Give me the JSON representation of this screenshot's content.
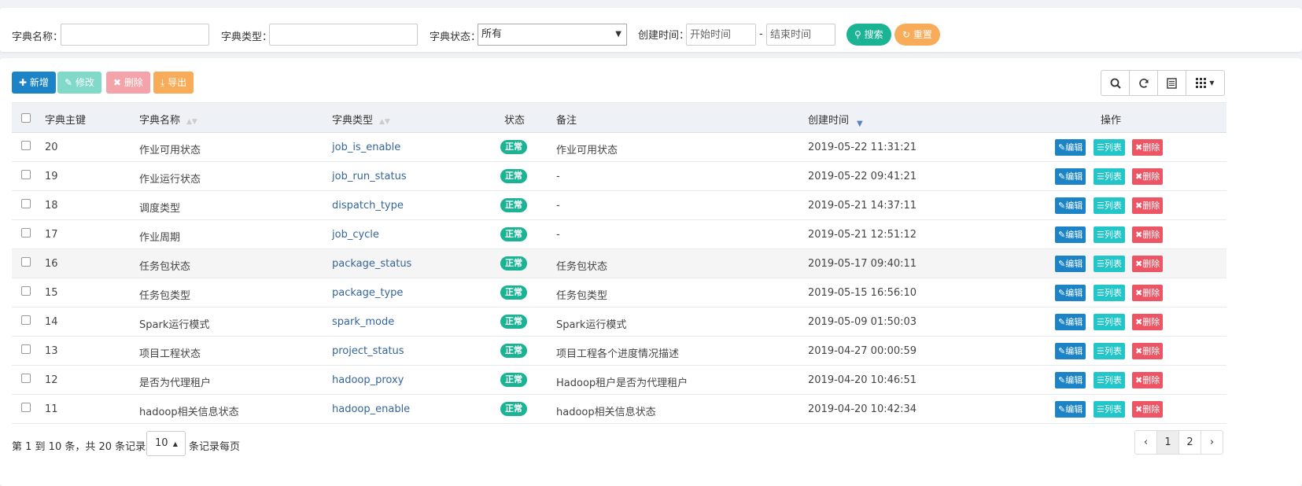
{
  "search": {
    "dict_name_label": "字典名称：",
    "dict_type_label": "字典类型：",
    "dict_status_label": "字典状态：",
    "dict_status_value": "所有",
    "create_time_label": "创建时间：",
    "start_placeholder": "开始时间",
    "dash": "-",
    "end_placeholder": "结束时间",
    "search_button": "搜索",
    "reset_button": "重置"
  },
  "toolbar": {
    "add": "新增",
    "edit": "修改",
    "delete": "删除",
    "export": "导出"
  },
  "table": {
    "headers": {
      "id": "字典主键",
      "name": "字典名称",
      "type": "字典类型",
      "status": "状态",
      "remark": "备注",
      "created": "创建时间",
      "actions": "操作"
    },
    "actions": {
      "edit": "编辑",
      "list": "列表",
      "delete": "删除"
    },
    "rows": [
      {
        "id": "20",
        "name": "作业可用状态",
        "type": "job_is_enable",
        "status": "正常",
        "remark": "作业可用状态",
        "created": "2019-05-22 11:31:21"
      },
      {
        "id": "19",
        "name": "作业运行状态",
        "type": "job_run_status",
        "status": "正常",
        "remark": "-",
        "created": "2019-05-22 09:41:21"
      },
      {
        "id": "18",
        "name": "调度类型",
        "type": "dispatch_type",
        "status": "正常",
        "remark": "-",
        "created": "2019-05-21 14:37:11"
      },
      {
        "id": "17",
        "name": "作业周期",
        "type": "job_cycle",
        "status": "正常",
        "remark": "-",
        "created": "2019-05-21 12:51:12"
      },
      {
        "id": "16",
        "name": "任务包状态",
        "type": "package_status",
        "status": "正常",
        "remark": "任务包状态",
        "created": "2019-05-17 09:40:11"
      },
      {
        "id": "15",
        "name": "任务包类型",
        "type": "package_type",
        "status": "正常",
        "remark": "任务包类型",
        "created": "2019-05-15 16:56:10"
      },
      {
        "id": "14",
        "name": "Spark运行模式",
        "type": "spark_mode",
        "status": "正常",
        "remark": "Spark运行模式",
        "created": "2019-05-09 01:50:03"
      },
      {
        "id": "13",
        "name": "项目工程状态",
        "type": "project_status",
        "status": "正常",
        "remark": "项目工程各个进度情况描述",
        "created": "2019-04-27 00:00:59"
      },
      {
        "id": "12",
        "name": "是否为代理租户",
        "type": "hadoop_proxy",
        "status": "正常",
        "remark": "Hadoop租户是否为代理租户",
        "created": "2019-04-20 10:46:51"
      },
      {
        "id": "11",
        "name": "hadoop相关信息状态",
        "type": "hadoop_enable",
        "status": "正常",
        "remark": "hadoop相关信息状态",
        "created": "2019-04-20 10:42:34"
      }
    ]
  },
  "footer": {
    "summary": "第 1 到 10 条，共 20 条记录。",
    "page_size": "10",
    "per_page": "条记录每页",
    "prev": "‹",
    "pages": [
      "1",
      "2"
    ],
    "next": "›"
  }
}
